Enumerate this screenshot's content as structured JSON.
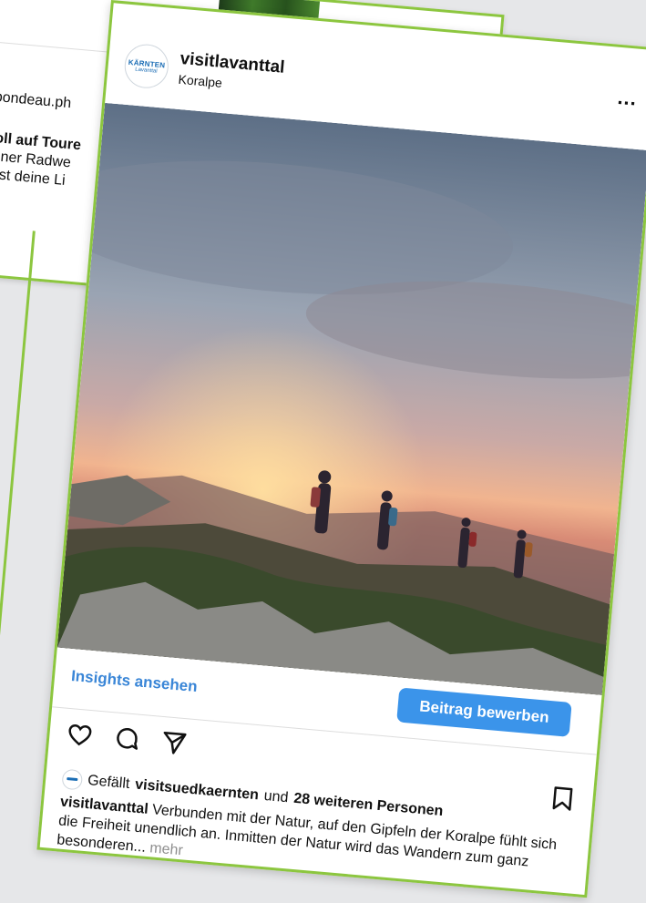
{
  "back_post": {
    "lines": [
      "tribondeau.ph",
      "svoll auf Toure",
      "chöner Radwe",
      "ne ist deine Li",
      "🚴"
    ]
  },
  "post": {
    "username": "visitlavanttal",
    "location": "Koralpe",
    "avatar_text_top": "KÄRNTEN",
    "avatar_text_bottom": "Lavanttal",
    "more_label": "...",
    "insights_label": "Insights ansehen",
    "promote_label": "Beitrag bewerben",
    "likes": {
      "prefix": "Gefällt",
      "liked_by": "visitsuedkaernten",
      "conjunction": "und",
      "others": "28 weiteren Personen"
    },
    "caption": {
      "author": "visitlavanttal",
      "text": "Verbunden mit der Natur, auf den Gipfeln der Koralpe fühlt sich die Freiheit unendlich an. Inmitten der Natur wird das Wandern zum ganz besonderen...",
      "more": "mehr"
    }
  },
  "icons": [
    "heart-icon",
    "comment-icon",
    "share-icon",
    "bookmark-icon"
  ],
  "colors": {
    "border_accent": "#8cc63f",
    "link_blue": "#3a86d7",
    "button_blue": "#3b94ea"
  }
}
